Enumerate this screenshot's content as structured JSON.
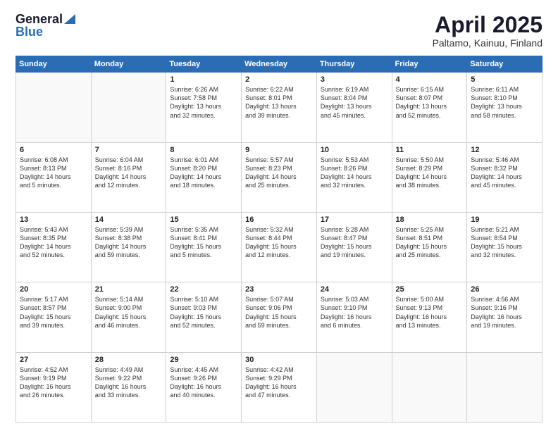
{
  "header": {
    "logo_general": "General",
    "logo_blue": "Blue",
    "month_title": "April 2025",
    "location": "Paltamo, Kainuu, Finland"
  },
  "weekdays": [
    "Sunday",
    "Monday",
    "Tuesday",
    "Wednesday",
    "Thursday",
    "Friday",
    "Saturday"
  ],
  "weeks": [
    [
      {
        "day": "",
        "info": ""
      },
      {
        "day": "",
        "info": ""
      },
      {
        "day": "1",
        "info": "Sunrise: 6:26 AM\nSunset: 7:58 PM\nDaylight: 13 hours\nand 32 minutes."
      },
      {
        "day": "2",
        "info": "Sunrise: 6:22 AM\nSunset: 8:01 PM\nDaylight: 13 hours\nand 39 minutes."
      },
      {
        "day": "3",
        "info": "Sunrise: 6:19 AM\nSunset: 8:04 PM\nDaylight: 13 hours\nand 45 minutes."
      },
      {
        "day": "4",
        "info": "Sunrise: 6:15 AM\nSunset: 8:07 PM\nDaylight: 13 hours\nand 52 minutes."
      },
      {
        "day": "5",
        "info": "Sunrise: 6:11 AM\nSunset: 8:10 PM\nDaylight: 13 hours\nand 58 minutes."
      }
    ],
    [
      {
        "day": "6",
        "info": "Sunrise: 6:08 AM\nSunset: 8:13 PM\nDaylight: 14 hours\nand 5 minutes."
      },
      {
        "day": "7",
        "info": "Sunrise: 6:04 AM\nSunset: 8:16 PM\nDaylight: 14 hours\nand 12 minutes."
      },
      {
        "day": "8",
        "info": "Sunrise: 6:01 AM\nSunset: 8:20 PM\nDaylight: 14 hours\nand 18 minutes."
      },
      {
        "day": "9",
        "info": "Sunrise: 5:57 AM\nSunset: 8:23 PM\nDaylight: 14 hours\nand 25 minutes."
      },
      {
        "day": "10",
        "info": "Sunrise: 5:53 AM\nSunset: 8:26 PM\nDaylight: 14 hours\nand 32 minutes."
      },
      {
        "day": "11",
        "info": "Sunrise: 5:50 AM\nSunset: 8:29 PM\nDaylight: 14 hours\nand 38 minutes."
      },
      {
        "day": "12",
        "info": "Sunrise: 5:46 AM\nSunset: 8:32 PM\nDaylight: 14 hours\nand 45 minutes."
      }
    ],
    [
      {
        "day": "13",
        "info": "Sunrise: 5:43 AM\nSunset: 8:35 PM\nDaylight: 14 hours\nand 52 minutes."
      },
      {
        "day": "14",
        "info": "Sunrise: 5:39 AM\nSunset: 8:38 PM\nDaylight: 14 hours\nand 59 minutes."
      },
      {
        "day": "15",
        "info": "Sunrise: 5:35 AM\nSunset: 8:41 PM\nDaylight: 15 hours\nand 5 minutes."
      },
      {
        "day": "16",
        "info": "Sunrise: 5:32 AM\nSunset: 8:44 PM\nDaylight: 15 hours\nand 12 minutes."
      },
      {
        "day": "17",
        "info": "Sunrise: 5:28 AM\nSunset: 8:47 PM\nDaylight: 15 hours\nand 19 minutes."
      },
      {
        "day": "18",
        "info": "Sunrise: 5:25 AM\nSunset: 8:51 PM\nDaylight: 15 hours\nand 25 minutes."
      },
      {
        "day": "19",
        "info": "Sunrise: 5:21 AM\nSunset: 8:54 PM\nDaylight: 15 hours\nand 32 minutes."
      }
    ],
    [
      {
        "day": "20",
        "info": "Sunrise: 5:17 AM\nSunset: 8:57 PM\nDaylight: 15 hours\nand 39 minutes."
      },
      {
        "day": "21",
        "info": "Sunrise: 5:14 AM\nSunset: 9:00 PM\nDaylight: 15 hours\nand 46 minutes."
      },
      {
        "day": "22",
        "info": "Sunrise: 5:10 AM\nSunset: 9:03 PM\nDaylight: 15 hours\nand 52 minutes."
      },
      {
        "day": "23",
        "info": "Sunrise: 5:07 AM\nSunset: 9:06 PM\nDaylight: 15 hours\nand 59 minutes."
      },
      {
        "day": "24",
        "info": "Sunrise: 5:03 AM\nSunset: 9:10 PM\nDaylight: 16 hours\nand 6 minutes."
      },
      {
        "day": "25",
        "info": "Sunrise: 5:00 AM\nSunset: 9:13 PM\nDaylight: 16 hours\nand 13 minutes."
      },
      {
        "day": "26",
        "info": "Sunrise: 4:56 AM\nSunset: 9:16 PM\nDaylight: 16 hours\nand 19 minutes."
      }
    ],
    [
      {
        "day": "27",
        "info": "Sunrise: 4:52 AM\nSunset: 9:19 PM\nDaylight: 16 hours\nand 26 minutes."
      },
      {
        "day": "28",
        "info": "Sunrise: 4:49 AM\nSunset: 9:22 PM\nDaylight: 16 hours\nand 33 minutes."
      },
      {
        "day": "29",
        "info": "Sunrise: 4:45 AM\nSunset: 9:26 PM\nDaylight: 16 hours\nand 40 minutes."
      },
      {
        "day": "30",
        "info": "Sunrise: 4:42 AM\nSunset: 9:29 PM\nDaylight: 16 hours\nand 47 minutes."
      },
      {
        "day": "",
        "info": ""
      },
      {
        "day": "",
        "info": ""
      },
      {
        "day": "",
        "info": ""
      }
    ]
  ]
}
